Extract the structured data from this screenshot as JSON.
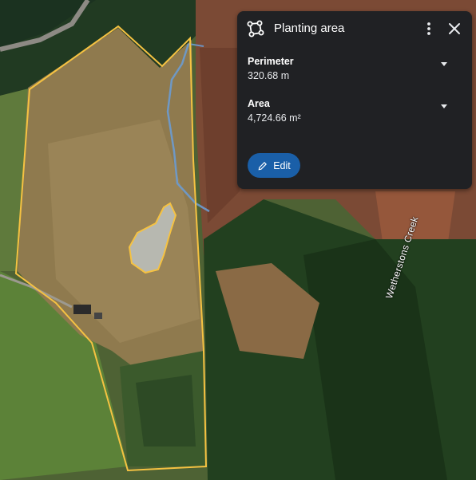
{
  "map": {
    "creek_label": "Wetherstons Creek"
  },
  "panel": {
    "title": "Planting area",
    "icons": {
      "title": "polygon-icon",
      "more": "more-vert-icon",
      "close": "close-icon",
      "edit": "pencil-icon",
      "expand": "caret-down-icon"
    },
    "measurements": [
      {
        "label": "Perimeter",
        "value": "320.68 m"
      },
      {
        "label": "Area",
        "value": "4,724.66 m²"
      }
    ],
    "edit_label": "Edit"
  },
  "colors": {
    "panel_bg": "#202124",
    "boundary": "#f5c242",
    "edit_button": "#1a5fa8"
  }
}
